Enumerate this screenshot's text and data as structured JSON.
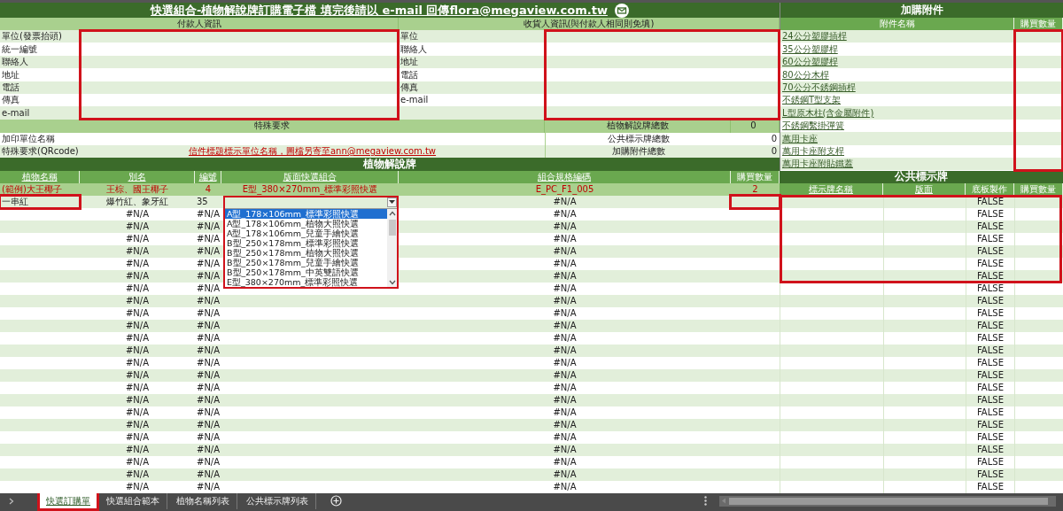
{
  "title": "快選組合-植物解說牌訂購電子檔  填完後請以 e-mail 回傳flora@megaview.com.tw",
  "payer": {
    "heading": "付款人資訊",
    "fields": [
      "單位(發票抬頭)",
      "統一編號",
      "聯絡人",
      "地址",
      "電話",
      "傳真",
      "e-mail"
    ]
  },
  "receiver": {
    "heading": "收貨人資訊(與付款人相同則免填)",
    "fields": [
      "單位",
      "聯絡人",
      "地址",
      "電話",
      "傳真",
      "e-mail"
    ]
  },
  "special": {
    "heading": "特殊要求",
    "rows": [
      {
        "label": "加印單位名稱"
      },
      {
        "label": "特殊要求(QRcode)",
        "link": "信件標題標示單位名稱，圖檔另寄至ann@megaview.com.tw"
      }
    ]
  },
  "totals": [
    {
      "label": "植物解說牌總數",
      "value": "0"
    },
    {
      "label": "公共標示牌總數",
      "value": "0"
    },
    {
      "label": "加購附件總數",
      "value": "0"
    }
  ],
  "accessories": {
    "title": "加購附件",
    "columns": [
      "附件名稱",
      "購買數量"
    ],
    "items": [
      "24公分塑膠插桿",
      "35公分塑膠桿",
      "60公分塑膠桿",
      "80公分木桿",
      "70公分不銹鋼插桿",
      "不銹鋼T型支架",
      "L型原木柱(含金屬附件)",
      "不銹鋼繫掛彈簧",
      "萬用卡座",
      "萬用卡座附支桿",
      "萬用卡座附貼鐵蓋"
    ]
  },
  "plaques": {
    "title": "植物解說牌",
    "columns": [
      "植物名稱",
      "別名",
      "編號",
      "版面快選組合",
      "組合規格編碼",
      "購買數量"
    ],
    "example": [
      "(範例)大王椰子",
      "王棕、國王椰子",
      "4",
      "E型_380×270mm_標準彩照快選",
      "E_PC_F1_005",
      "2"
    ],
    "rows": [
      {
        "name": "一串紅",
        "alias": "爆竹紅、象牙紅",
        "number": "35",
        "code": "#N/A"
      },
      {
        "alias": "#N/A",
        "number": "#N/A",
        "code": "#N/A"
      },
      {
        "alias": "#N/A",
        "number": "#N/A",
        "code": "#N/A"
      },
      {
        "alias": "#N/A",
        "number": "#N/A",
        "code": "#N/A"
      },
      {
        "alias": "#N/A",
        "number": "#N/A",
        "code": "#N/A"
      },
      {
        "alias": "#N/A",
        "number": "#N/A",
        "code": "#N/A"
      },
      {
        "alias": "#N/A",
        "number": "#N/A",
        "code": "#N/A"
      },
      {
        "alias": "#N/A",
        "number": "#N/A",
        "code": "#N/A"
      },
      {
        "alias": "#N/A",
        "number": "#N/A",
        "code": "#N/A"
      },
      {
        "alias": "#N/A",
        "number": "#N/A",
        "code": "#N/A"
      },
      {
        "alias": "#N/A",
        "number": "#N/A",
        "code": "#N/A"
      },
      {
        "alias": "#N/A",
        "number": "#N/A",
        "code": "#N/A"
      },
      {
        "alias": "#N/A",
        "number": "#N/A",
        "code": "#N/A"
      },
      {
        "alias": "#N/A",
        "number": "#N/A",
        "code": "#N/A"
      },
      {
        "alias": "#N/A",
        "number": "#N/A",
        "code": "#N/A"
      },
      {
        "alias": "#N/A",
        "number": "#N/A",
        "code": "#N/A"
      },
      {
        "alias": "#N/A",
        "number": "#N/A",
        "code": "#N/A"
      },
      {
        "alias": "#N/A",
        "number": "#N/A",
        "code": "#N/A"
      },
      {
        "alias": "#N/A",
        "number": "#N/A",
        "code": "#N/A"
      },
      {
        "alias": "#N/A",
        "number": "#N/A",
        "code": "#N/A"
      },
      {
        "alias": "#N/A",
        "number": "#N/A",
        "code": "#N/A"
      },
      {
        "alias": "#N/A",
        "number": "#N/A",
        "code": "#N/A"
      },
      {
        "alias": "#N/A",
        "number": "#N/A",
        "code": "#N/A"
      },
      {
        "alias": "#N/A",
        "number": "#N/A",
        "code": "#N/A"
      }
    ]
  },
  "dropdown": {
    "options": [
      {
        "label": "A型_178×106mm_標準彩照快選",
        "selected": true
      },
      {
        "label": "A型_178×106mm_植物大照快選",
        "selected": false
      },
      {
        "label": "A型_178×106mm_兒童手繪快選",
        "selected": false
      },
      {
        "label": "B型_250×178mm_標準彩照快選",
        "selected": false
      },
      {
        "label": "B型_250×178mm_植物大照快選",
        "selected": false
      },
      {
        "label": "B型_250×178mm_兒童手繪快選",
        "selected": false
      },
      {
        "label": "B型_250×178mm_中英雙語快選",
        "selected": false
      },
      {
        "label": "E型_380×270mm_標準彩照快選",
        "selected": false
      }
    ]
  },
  "public_signs": {
    "title": "公共標示牌",
    "columns": [
      "標示牌名稱",
      "版面",
      "底板製作",
      "購買數量"
    ],
    "base_values": [
      "FALSE",
      "FALSE",
      "FALSE",
      "FALSE",
      "FALSE",
      "FALSE",
      "FALSE",
      "FALSE",
      "FALSE",
      "FALSE",
      "FALSE",
      "FALSE",
      "FALSE",
      "FALSE",
      "FALSE",
      "FALSE",
      "FALSE",
      "FALSE",
      "FALSE",
      "FALSE",
      "FALSE",
      "FALSE",
      "FALSE",
      "FALSE"
    ]
  },
  "sheet_tabs": [
    {
      "label": "快選訂購單",
      "selected": true
    },
    {
      "label": "快選組合範本",
      "selected": false
    },
    {
      "label": "植物名稱列表",
      "selected": false
    },
    {
      "label": "公共標示牌列表",
      "selected": false
    }
  ]
}
